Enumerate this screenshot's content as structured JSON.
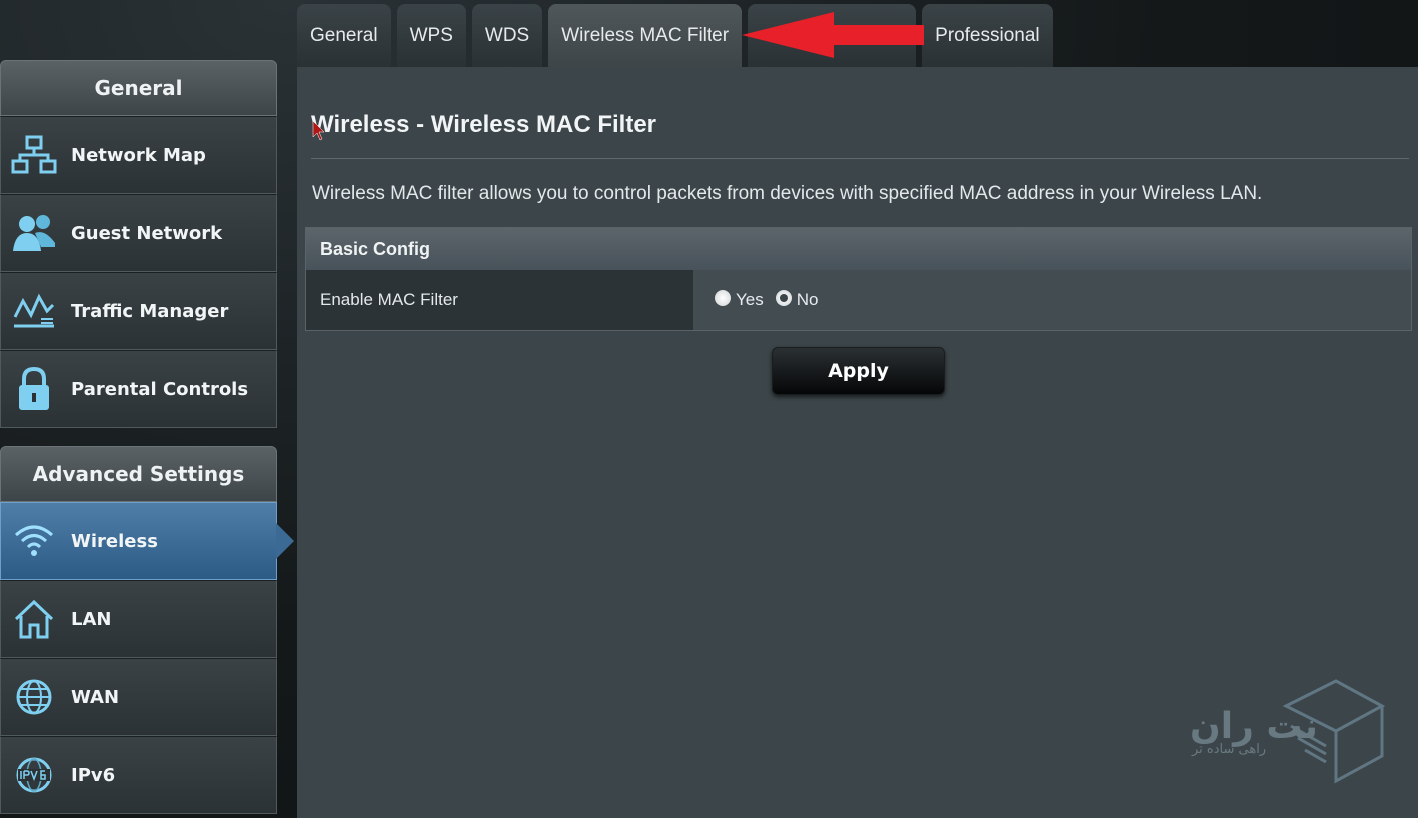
{
  "tabs": [
    {
      "label": "General"
    },
    {
      "label": "WPS"
    },
    {
      "label": "WDS"
    },
    {
      "label": "Wireless MAC Filter",
      "active": true
    },
    {
      "label": ""
    },
    {
      "label": "Professional"
    }
  ],
  "sidebar": {
    "general_header": "General",
    "general_items": [
      {
        "label": "Network Map",
        "icon": "network-map-icon"
      },
      {
        "label": "Guest Network",
        "icon": "guest-network-icon"
      },
      {
        "label": "Traffic Manager",
        "icon": "traffic-manager-icon"
      },
      {
        "label": "Parental Controls",
        "icon": "lock-icon"
      }
    ],
    "advanced_header": "Advanced Settings",
    "advanced_items": [
      {
        "label": "Wireless",
        "icon": "wifi-icon",
        "active": true
      },
      {
        "label": "LAN",
        "icon": "home-icon"
      },
      {
        "label": "WAN",
        "icon": "globe-icon"
      },
      {
        "label": "IPv6",
        "icon": "ipv6-icon"
      }
    ]
  },
  "main": {
    "title": "Wireless - Wireless MAC Filter",
    "description": "Wireless MAC filter allows you to control packets from devices with specified MAC address in your Wireless LAN.",
    "section_header": "Basic Config",
    "enable_label": "Enable MAC Filter",
    "options": {
      "yes": "Yes",
      "no": "No",
      "selected": "No"
    },
    "apply_label": "Apply"
  },
  "watermark": {
    "text": "نت ران",
    "sub": "راهی ساده تر"
  },
  "colors": {
    "active_blue": "#3b6a94",
    "annotation_red": "#e8202a"
  }
}
